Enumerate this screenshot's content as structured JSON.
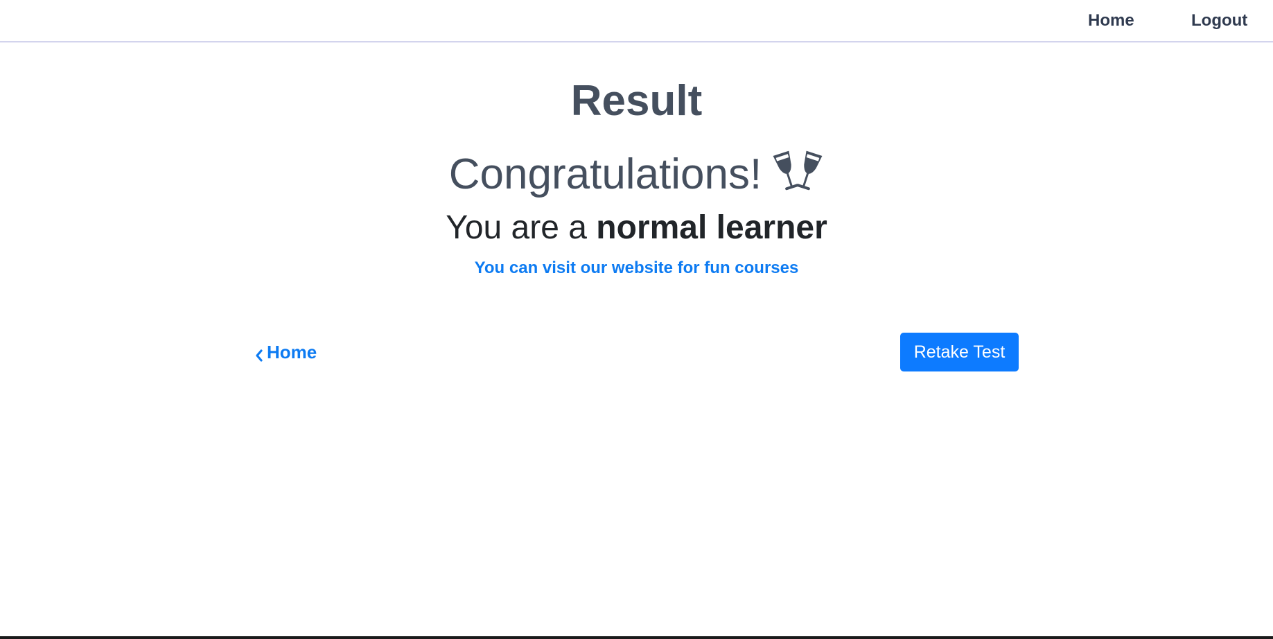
{
  "navbar": {
    "home_label": "Home",
    "logout_label": "Logout"
  },
  "result": {
    "title": "Result",
    "congrats": "Congratulations!",
    "congrats_icon": "cheers-icon",
    "learner_prefix": "You are a ",
    "learner_type": "normal learner",
    "visit_text": "You can visit our website for fun courses"
  },
  "actions": {
    "back_home_label": "Home",
    "back_icon": "chevron-left-icon",
    "retake_label": "Retake Test"
  },
  "colors": {
    "accent": "#0d7bff",
    "heading": "#454f5e",
    "nav_text": "#2f3a4f",
    "nav_border": "#8c8fd0"
  }
}
